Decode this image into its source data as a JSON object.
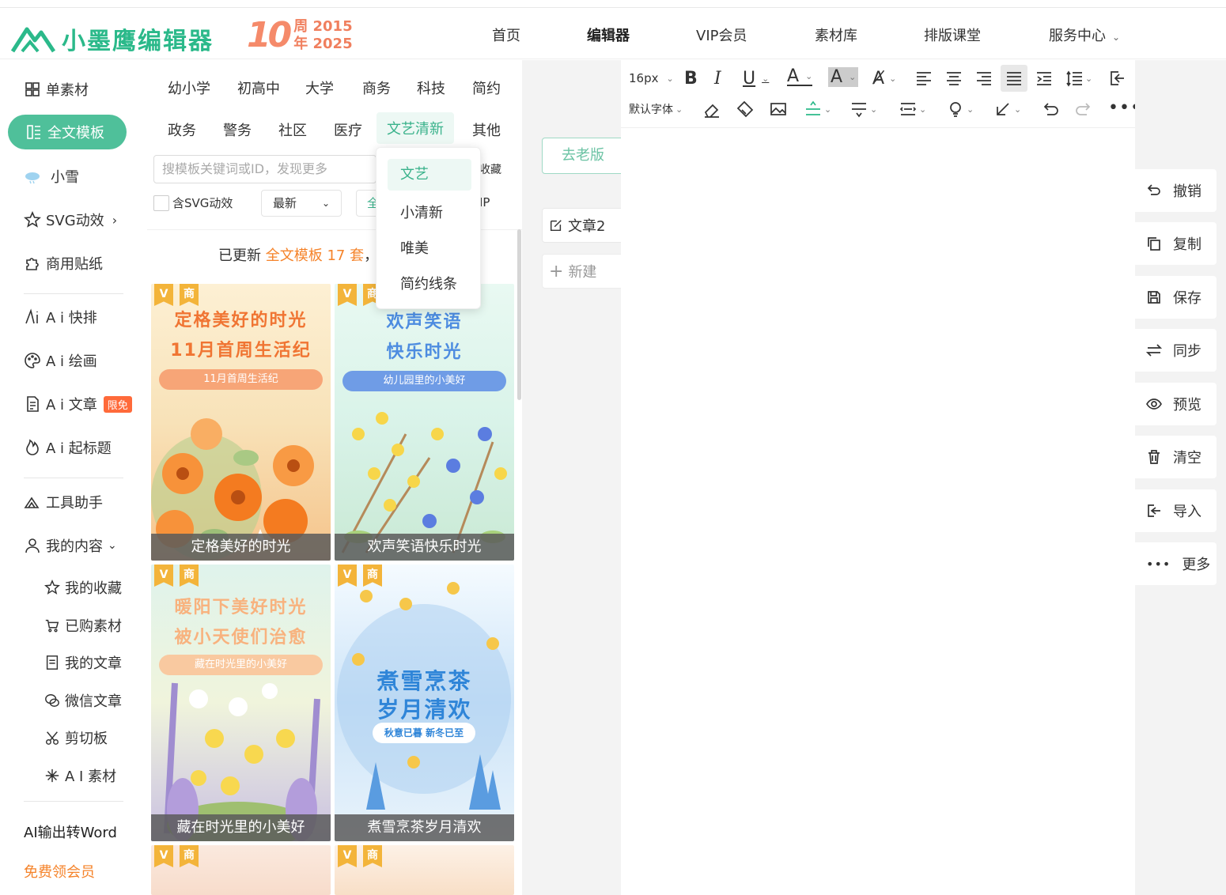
{
  "brand": {
    "name": "小墨鹰编辑器",
    "anniv_num": "10",
    "anniv_line1": "周 2015",
    "anniv_line2": "年 2025"
  },
  "nav": {
    "items": [
      "首页",
      "编辑器",
      "VIP会员",
      "素材库",
      "排版课堂",
      "服务中心"
    ]
  },
  "leftnav": {
    "single": "单素材",
    "full": "全文模板",
    "xiaoxue": "小雪",
    "svg": "SVG动效",
    "stickers": "商用贴纸",
    "ai_kuaipai": "A i 快排",
    "ai_huihua": "A i 绘画",
    "ai_wenzhang": "A i 文章",
    "ai_badge": "限免",
    "ai_biaoti": "A i 起标题",
    "tools": "工具助手",
    "mycontent": "我的内容",
    "sub": [
      "我的收藏",
      "已购素材",
      "我的文章",
      "微信文章",
      "剪切板",
      "A I 素材"
    ],
    "ai_word": "AI输出转Word",
    "free_vip": "免费领会员"
  },
  "categories": {
    "row1": [
      "幼小学",
      "初高中",
      "大学",
      "商务",
      "科技",
      "简约"
    ],
    "row2": [
      "政务",
      "警务",
      "社区",
      "医疗",
      "文艺清新",
      "其他"
    ],
    "active": "文艺清新"
  },
  "search": {
    "placeholder": "搜模板关键词或ID，发现更多",
    "fav_frag": "收藏"
  },
  "filters": {
    "svg_label": "含SVG动效",
    "sort": "最新",
    "frag_all": "全",
    "frag_vip": "IP"
  },
  "notice": {
    "pre": "已更新 ",
    "hl": "全文模板 17 套",
    "post": "，"
  },
  "dropdown": {
    "items": [
      "文艺",
      "小清新",
      "唯美",
      "简约线条"
    ]
  },
  "cards": [
    {
      "title1": "定格美好的时光",
      "title2": "11月首周生活纪",
      "pill": "11月首周生活纪",
      "caption": "定格美好的时光"
    },
    {
      "title1": "欢声笑语",
      "title2": "快乐时光",
      "pill": "幼儿园里的小美好",
      "caption": "欢声笑语快乐时光"
    },
    {
      "title1": "暖阳下美好时光",
      "title2": "被小天使们治愈",
      "pill": "藏在时光里的小美好",
      "caption": "藏在时光里的小美好"
    },
    {
      "title1": "煮雪烹茶",
      "title2": "岁月清欢",
      "pill": "秋意已暮 新冬已至",
      "caption": "煮雪烹茶岁月清欢"
    }
  ],
  "tags": {
    "v": "V",
    "shang": "商"
  },
  "workspace": {
    "old_version": "去老版",
    "article": "文章2",
    "new": "新建"
  },
  "toolbar": {
    "font_size": "16px",
    "font_family": "默认字体"
  },
  "rightpanel": [
    "撤销",
    "复制",
    "保存",
    "同步",
    "预览",
    "清空",
    "导入",
    "更多"
  ],
  "colors": {
    "accent": "#4fc09a",
    "orange": "#f5832a",
    "red_badge": "#ff6a3a"
  }
}
